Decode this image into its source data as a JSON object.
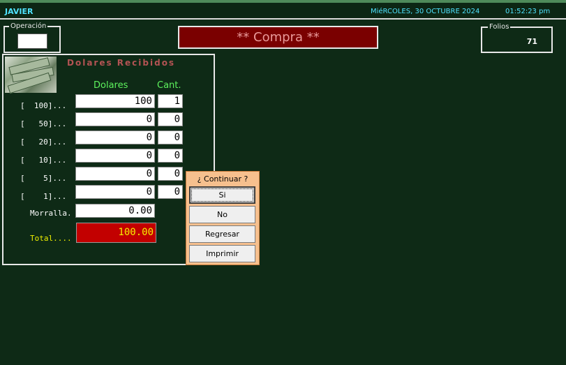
{
  "header": {
    "user": "JAVIER",
    "date": "MiéRCOLES, 30  OCTUBRE 2024",
    "time": "01:52:23 pm"
  },
  "operacion": {
    "legend": "Operación",
    "value": ""
  },
  "banner": {
    "text": "** Compra **"
  },
  "folios": {
    "legend": "Folios",
    "value": "71"
  },
  "panel": {
    "title": "Dolares Recibidos",
    "col_dolares": "Dolares",
    "col_cant": "Cant.",
    "rows": [
      {
        "label": "[  100]...",
        "dolares": "100",
        "cant": "1"
      },
      {
        "label": "[   50]...",
        "dolares": "0",
        "cant": "0"
      },
      {
        "label": "[   20]...",
        "dolares": "0",
        "cant": "0"
      },
      {
        "label": "[   10]...",
        "dolares": "0",
        "cant": "0"
      },
      {
        "label": "[    5]...",
        "dolares": "0",
        "cant": "0"
      },
      {
        "label": "[    1]...",
        "dolares": "0",
        "cant": "0"
      }
    ],
    "morralla_label": "Morralla.",
    "morralla_value": "0.00",
    "total_label": "Total....",
    "total_value": "100.00"
  },
  "dialog": {
    "title": "¿ Continuar ?",
    "buttons": [
      "Si",
      "No",
      "Regresar",
      "Imprimir"
    ]
  },
  "colors": {
    "background": "#0e2a16",
    "accent_cyan": "#4fe3ff",
    "banner_red": "#7a0000",
    "total_red": "#c20000",
    "dialog_orange": "#f6c08e"
  }
}
